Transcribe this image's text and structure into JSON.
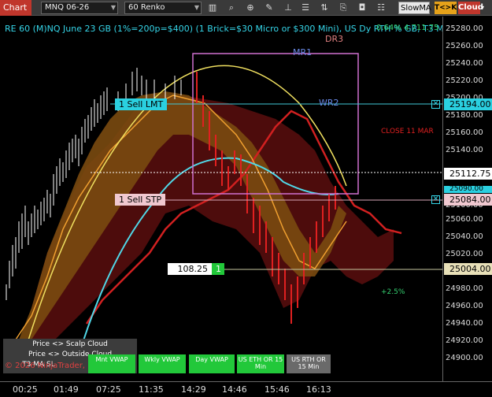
{
  "toolbar": {
    "chart_tab": "Chart",
    "instrument": "MNQ 06-26",
    "bars_type": "60 Renko",
    "ma_select": "SlowMA",
    "tc_button": "T<>K",
    "cloud_button": "Cloud"
  },
  "chart": {
    "title": "RE 60 (M)NQ June 23 GB (1%=200p=$400) (1 Brick=$30 Micro or $300 Mini), US Dy RTH % GB, T3 MA SL",
    "overlay_right": "0.64% 4 711.75",
    "labels": {
      "dr3": "DR3",
      "mr1": "MR1",
      "wr2": "WR2",
      "close": "CLOSE 11 MAR",
      "pct": "+2.5%"
    }
  },
  "orders": {
    "sell_lmt": "1 Sell LMT",
    "sell_stp": "1 Sell STP",
    "pnl": "108.25",
    "qty": "1"
  },
  "price_axis": {
    "ticks": [
      "25280.00",
      "25260.00",
      "25240.00",
      "25220.00",
      "25200.00",
      "25180.00",
      "25160.00",
      "25140.00",
      "25100.00",
      "25060.00",
      "25040.00",
      "25020.00",
      "24980.00",
      "24960.00",
      "24940.00",
      "24920.00",
      "24900.00"
    ],
    "tag_194": "25194.00",
    "tag_112": "25112.75",
    "tag_090": "25090.00",
    "tag_084": "25084.00",
    "tag_004": "25004.00"
  },
  "time_axis": [
    "00:25",
    "01:49",
    "07:25",
    "11:35",
    "14:29",
    "14:46",
    "15:46",
    "16:13"
  ],
  "vwap_buttons": {
    "price_scalp": "Price <> Scalp Cloud",
    "price_outside": "Price <> Outside Cloud",
    "t3": "T3 MA SL",
    "mnt": "Mnt VWAP",
    "wkly": "Wkly VWAP",
    "day": "Day VWAP",
    "us_eth": "US ETH OR 15 Min",
    "us_rth": "US RTH OR 15 Min"
  },
  "copyright": "© 2026 NinjaTrader, LLC",
  "colors": {
    "cyan": "#35d5e8",
    "orange": "#e08a1e",
    "red": "#d02020",
    "green": "#22c83a"
  }
}
